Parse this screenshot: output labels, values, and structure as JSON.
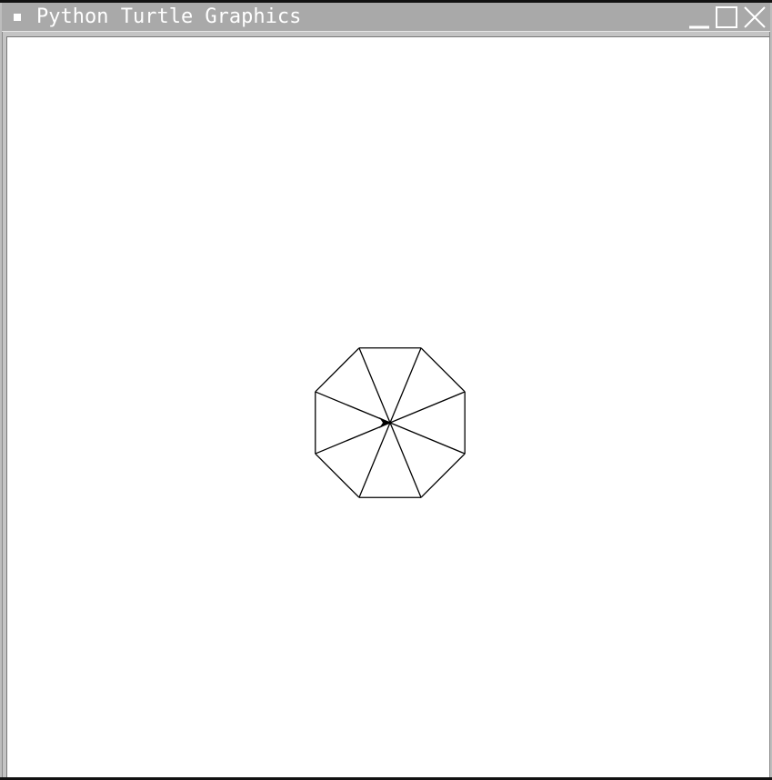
{
  "window": {
    "title": "Python Turtle Graphics",
    "menu_icon": "window-menu-icon",
    "controls": {
      "minimize_icon": "minimize-icon",
      "maximize_icon": "maximize-icon",
      "close_icon": "close-icon"
    }
  },
  "drawing": {
    "shape": "octagon with spokes",
    "sides": 8,
    "pen_color": "#000000",
    "turtle_icon": "turtle-arrow-icon",
    "turtle_heading": "east"
  },
  "colors": {
    "titlebar": "#a9a9a9",
    "title_text": "#ffffff",
    "canvas": "#ffffff"
  }
}
